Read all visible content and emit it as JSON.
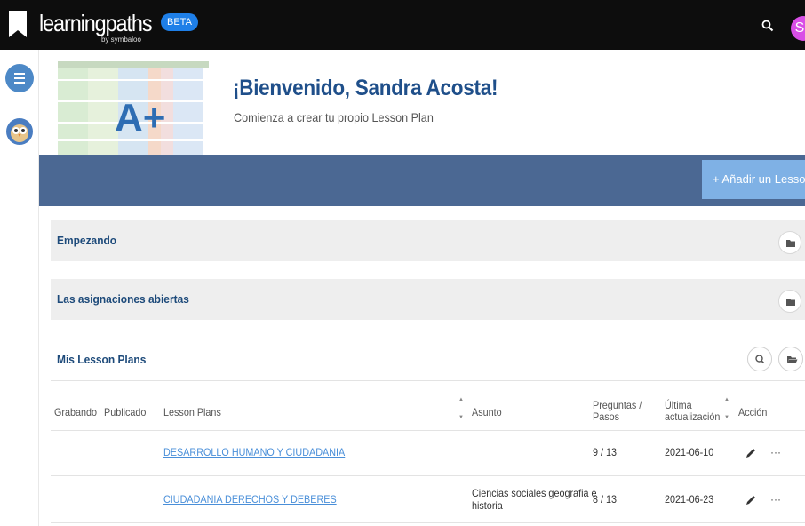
{
  "app": {
    "logo_text": "learningpaths",
    "logo_sub": "by symbaloo",
    "beta_label": "BETA",
    "avatar_initial": "S"
  },
  "welcome": {
    "title": "¡Bienvenido, Sandra Acosta!",
    "subtitle": "Comienza a crear tu propio Lesson Plan",
    "image_text": "A+"
  },
  "toolbar": {
    "add_label": "+  Añadir un Lesson Plan"
  },
  "sections": [
    {
      "title": "Empezando"
    },
    {
      "title": "Las asignaciones abiertas"
    }
  ],
  "lesson_plans": {
    "title": "Mis Lesson Plans",
    "columns": {
      "grabando": "Grabando",
      "publicado": "Publicado",
      "lesson_plans": "Lesson Plans",
      "asunto": "Asunto",
      "preguntas_1": "Preguntas /",
      "preguntas_2": "Pasos",
      "ultima_1": "Última",
      "ultima_2": "actualización",
      "accion": "Acción"
    },
    "rows": [
      {
        "name": "DESARROLLO HUMANO Y CIUDADANIA",
        "subject_1": "",
        "subject_2": "",
        "count": "9 / 13",
        "date": "2021-06-10"
      },
      {
        "name": "CIUDADANIA DERECHOS Y DEBERES",
        "subject_1": "Ciencias sociales geografia e",
        "subject_2": "historia",
        "count": "8 / 13",
        "date": "2021-06-23"
      }
    ]
  },
  "colors": {
    "topbar": "#0d0d0d",
    "band": "#4b6893",
    "add_button": "#7fb1e5",
    "title_blue": "#1f4f8a",
    "link_blue": "#4a8fd9",
    "avatar": "#d84ee6",
    "beta": "#1e7fe8"
  },
  "icons": [
    "logo-bookmark-icon",
    "search-icon",
    "list-icon",
    "owl-icon",
    "folder-icon",
    "folder-open-icon",
    "pencil-icon",
    "more-dots-icon"
  ]
}
